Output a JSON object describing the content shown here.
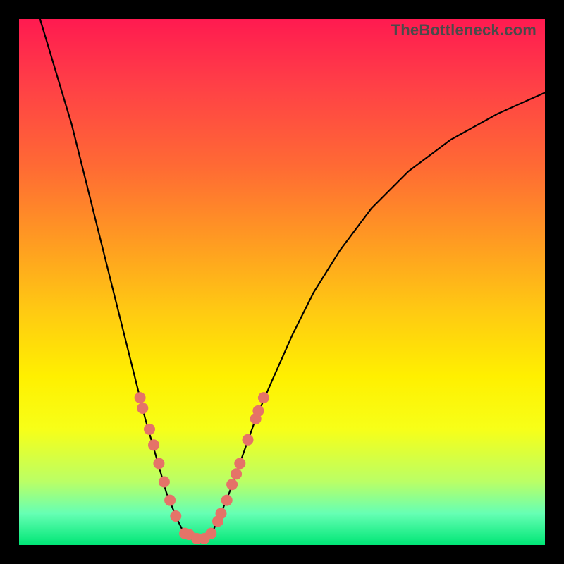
{
  "attribution": "TheBottleneck.com",
  "colors": {
    "frame": "#000000",
    "curve": "#000000",
    "dot": "#e57368",
    "gradient_top": "#ff1a50",
    "gradient_bottom": "#00e676"
  },
  "chart_data": {
    "type": "line",
    "title": "",
    "xlabel": "",
    "ylabel": "",
    "xlim": [
      0,
      100
    ],
    "ylim": [
      0,
      100
    ],
    "curve": [
      {
        "x": 4,
        "y": 100
      },
      {
        "x": 7,
        "y": 90
      },
      {
        "x": 10,
        "y": 80
      },
      {
        "x": 12.5,
        "y": 70
      },
      {
        "x": 15,
        "y": 60
      },
      {
        "x": 17.5,
        "y": 50
      },
      {
        "x": 20,
        "y": 40
      },
      {
        "x": 22,
        "y": 32
      },
      {
        "x": 24,
        "y": 24
      },
      {
        "x": 26,
        "y": 17
      },
      {
        "x": 28,
        "y": 10
      },
      {
        "x": 30,
        "y": 5
      },
      {
        "x": 31.5,
        "y": 2
      },
      {
        "x": 33,
        "y": 1
      },
      {
        "x": 35,
        "y": 1
      },
      {
        "x": 36.5,
        "y": 2
      },
      {
        "x": 38,
        "y": 5
      },
      {
        "x": 40,
        "y": 10
      },
      {
        "x": 42.5,
        "y": 17
      },
      {
        "x": 45,
        "y": 24
      },
      {
        "x": 48,
        "y": 31
      },
      {
        "x": 52,
        "y": 40
      },
      {
        "x": 56,
        "y": 48
      },
      {
        "x": 61,
        "y": 56
      },
      {
        "x": 67,
        "y": 64
      },
      {
        "x": 74,
        "y": 71
      },
      {
        "x": 82,
        "y": 77
      },
      {
        "x": 91,
        "y": 82
      },
      {
        "x": 100,
        "y": 86
      }
    ],
    "dots_left": [
      {
        "x": 23.0,
        "y": 28
      },
      {
        "x": 23.5,
        "y": 26
      },
      {
        "x": 24.8,
        "y": 22
      },
      {
        "x": 25.6,
        "y": 19
      },
      {
        "x": 26.6,
        "y": 15.5
      },
      {
        "x": 27.6,
        "y": 12
      },
      {
        "x": 28.7,
        "y": 8.5
      },
      {
        "x": 29.8,
        "y": 5.5
      }
    ],
    "dots_bottom": [
      {
        "x": 31.5,
        "y": 2.2
      },
      {
        "x": 32.3,
        "y": 2.0
      },
      {
        "x": 33.8,
        "y": 1.2
      },
      {
        "x": 35.2,
        "y": 1.2
      },
      {
        "x": 36.5,
        "y": 2.2
      }
    ],
    "dots_right": [
      {
        "x": 37.8,
        "y": 4.5
      },
      {
        "x": 38.4,
        "y": 6.0
      },
      {
        "x": 39.5,
        "y": 8.5
      },
      {
        "x": 40.5,
        "y": 11.5
      },
      {
        "x": 41.3,
        "y": 13.5
      },
      {
        "x": 42.0,
        "y": 15.5
      },
      {
        "x": 43.5,
        "y": 20.0
      },
      {
        "x": 45.0,
        "y": 24.0
      },
      {
        "x": 45.5,
        "y": 25.5
      },
      {
        "x": 46.5,
        "y": 28.0
      }
    ]
  }
}
